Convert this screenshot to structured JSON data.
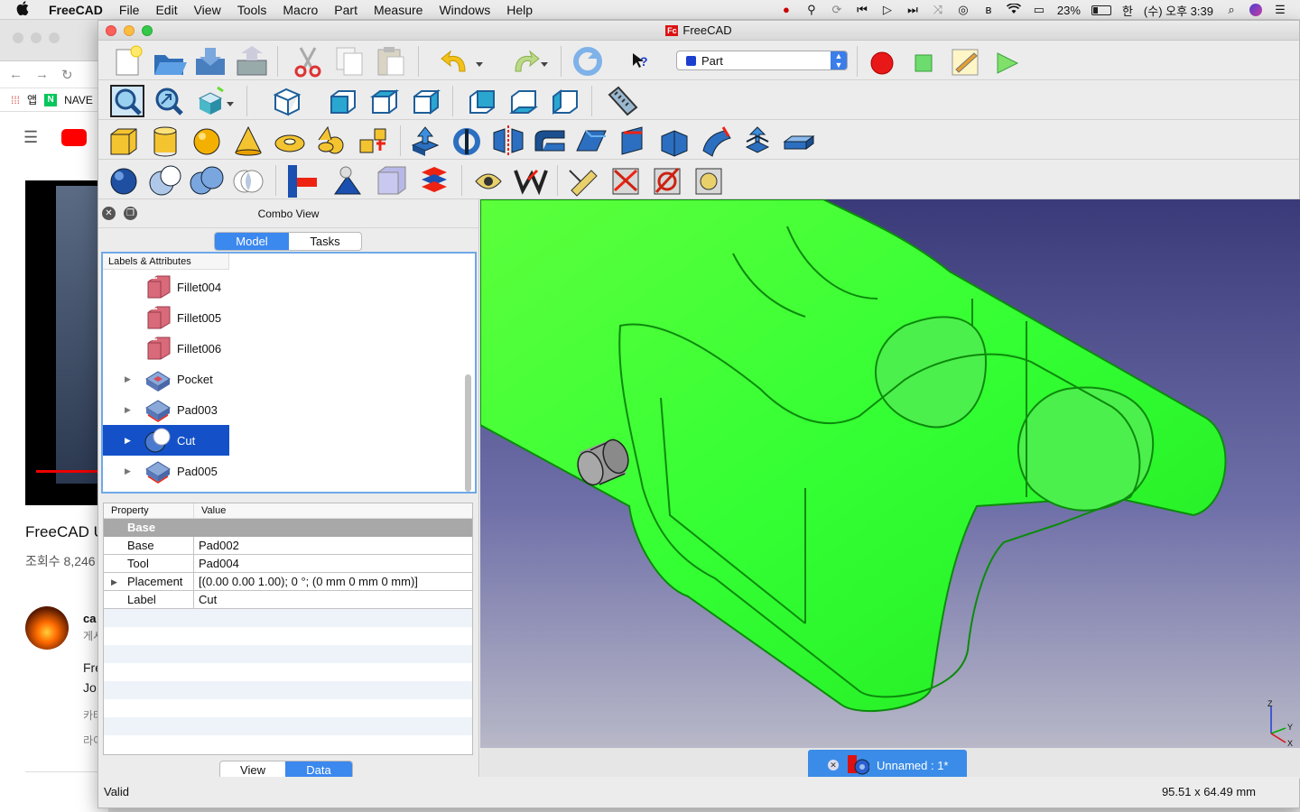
{
  "menubar": {
    "apple": "",
    "app": "FreeCAD",
    "items": [
      "File",
      "Edit",
      "View",
      "Tools",
      "Macro",
      "Part",
      "Measure",
      "Windows",
      "Help"
    ],
    "battery": "23%",
    "input_source": "한",
    "clock": "(수) 오후 3:39"
  },
  "browser": {
    "bookmark_apps": "앱",
    "bookmark_naver": "NAVE",
    "video_title": "FreeCAD U",
    "video_views": "조회수 8,246",
    "channel_name": "ca",
    "channel_sub": "게시",
    "desc_lines": [
      "Fre",
      "Jo",
      "카테",
      "라이"
    ]
  },
  "window": {
    "title": "FreeCAD",
    "workbench": "Part"
  },
  "combo": {
    "title": "Combo View",
    "tabs": [
      "Model",
      "Tasks"
    ],
    "tree_header": "Labels & Attributes",
    "items": [
      {
        "label": "Fillet004",
        "expandable": false,
        "selected": false,
        "icon": "fillet-icon"
      },
      {
        "label": "Fillet005",
        "expandable": false,
        "selected": false,
        "icon": "fillet-icon"
      },
      {
        "label": "Fillet006",
        "expandable": false,
        "selected": false,
        "icon": "fillet-icon"
      },
      {
        "label": "Pocket",
        "expandable": true,
        "selected": false,
        "icon": "pocket-icon"
      },
      {
        "label": "Pad003",
        "expandable": true,
        "selected": false,
        "icon": "pad-icon"
      },
      {
        "label": "Cut",
        "expandable": true,
        "selected": true,
        "icon": "cut-icon"
      },
      {
        "label": "Pad005",
        "expandable": true,
        "selected": false,
        "icon": "pad-icon"
      }
    ],
    "prop_headers": [
      "Property",
      "Value"
    ],
    "group": "Base",
    "properties": [
      {
        "name": "Base",
        "value": "Pad002"
      },
      {
        "name": "Tool",
        "value": "Pad004"
      },
      {
        "name": "Placement",
        "value": "[(0.00 0.00 1.00); 0 °; (0 mm  0 mm  0 mm)]"
      },
      {
        "name": "Label",
        "value": "Cut"
      }
    ],
    "bottom_tabs": [
      "View",
      "Data"
    ]
  },
  "document_tab": "Unnamed : 1*",
  "status": {
    "left": "Valid",
    "right": "95.51 x 64.49 mm"
  },
  "colors": {
    "accent": "#3b88ee",
    "selection": "#1451c8",
    "model_green": "#33ff33"
  }
}
